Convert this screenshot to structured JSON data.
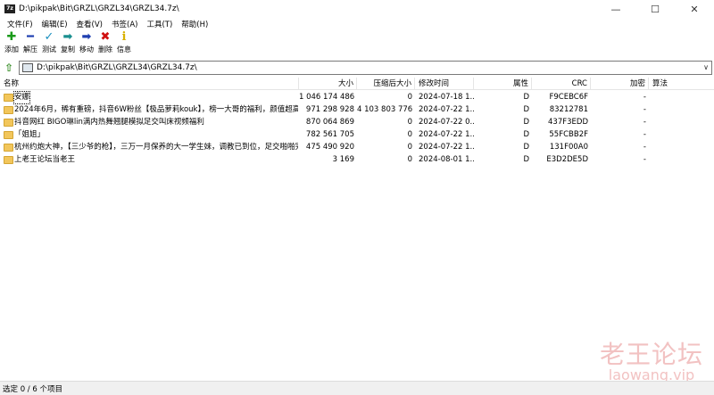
{
  "window": {
    "app_icon": "7z",
    "title": "D:\\pikpak\\Bit\\GRZL\\GRZL34\\GRZL34.7z\\",
    "minimize": "—",
    "maximize": "☐",
    "close": "✕"
  },
  "menu": [
    "文件(F)",
    "编辑(E)",
    "查看(V)",
    "书签(A)",
    "工具(T)",
    "帮助(H)"
  ],
  "toolbar": [
    {
      "icon": "add-icon",
      "glyph": "✚",
      "color": "#1a9a1a",
      "label": "添加"
    },
    {
      "icon": "extract-icon",
      "glyph": "━",
      "color": "#1f3fb0",
      "label": "解压"
    },
    {
      "icon": "test-icon",
      "glyph": "✓",
      "color": "#1a8fbf",
      "label": "测试"
    },
    {
      "icon": "copy-icon",
      "glyph": "➡",
      "color": "#1a8f8f",
      "label": "复制"
    },
    {
      "icon": "move-icon",
      "glyph": "➡",
      "color": "#1f3fb0",
      "label": "移动"
    },
    {
      "icon": "delete-icon",
      "glyph": "✖",
      "color": "#d01010",
      "label": "删除"
    },
    {
      "icon": "info-icon",
      "glyph": "i",
      "color": "#d8b000",
      "label": "信息"
    }
  ],
  "path": {
    "value": "D:\\pikpak\\Bit\\GRZL\\GRZL34\\GRZL34.7z\\"
  },
  "columns": {
    "name": "名称",
    "size": "大小",
    "packed": "压缩后大小",
    "modified": "修改时间",
    "attributes": "属性",
    "crc": "CRC",
    "encrypted": "加密",
    "method": "算法"
  },
  "rows": [
    {
      "name": "安娜",
      "size": "1 046 174 486",
      "packed": "0",
      "modified": "2024-07-18 1...",
      "attr": "D",
      "crc": "F9CEBC6F",
      "enc": "-"
    },
    {
      "name": "2024年6月，稀有重磅，抖音6W粉丝【极品萝莉kouk】，榜一大哥的福利，颜值超高，...",
      "size": "971 298 928",
      "packed": "4 103 803 776",
      "modified": "2024-07-22 1...",
      "attr": "D",
      "crc": "83212781",
      "enc": "-"
    },
    {
      "name": "抖音网红 BIGO琳lin满内热舞翘腿模拟足交叫床视频福利",
      "size": "870 064 869",
      "packed": "0",
      "modified": "2024-07-22 0...",
      "attr": "D",
      "crc": "437F3EDD",
      "enc": "-"
    },
    {
      "name": "「姐姐」",
      "size": "782 561 705",
      "packed": "0",
      "modified": "2024-07-22 1...",
      "attr": "D",
      "crc": "55FCBB2F",
      "enc": "-"
    },
    {
      "name": "杭州约炮大神，【三少爷的枪】，三万一月保养的大一学生妹，调教已到位，足交啪啪完美",
      "size": "475 490 920",
      "packed": "0",
      "modified": "2024-07-22 1...",
      "attr": "D",
      "crc": "131F00A0",
      "enc": "-"
    },
    {
      "name": "上老王论坛当老王",
      "size": "3 169",
      "packed": "0",
      "modified": "2024-08-01 1...",
      "attr": "D",
      "crc": "E3D2DE5D",
      "enc": "-"
    }
  ],
  "status": {
    "text": "选定 0 / 6 个项目"
  },
  "watermark": {
    "line1": "老王论坛",
    "line2": "laowang.vip"
  }
}
